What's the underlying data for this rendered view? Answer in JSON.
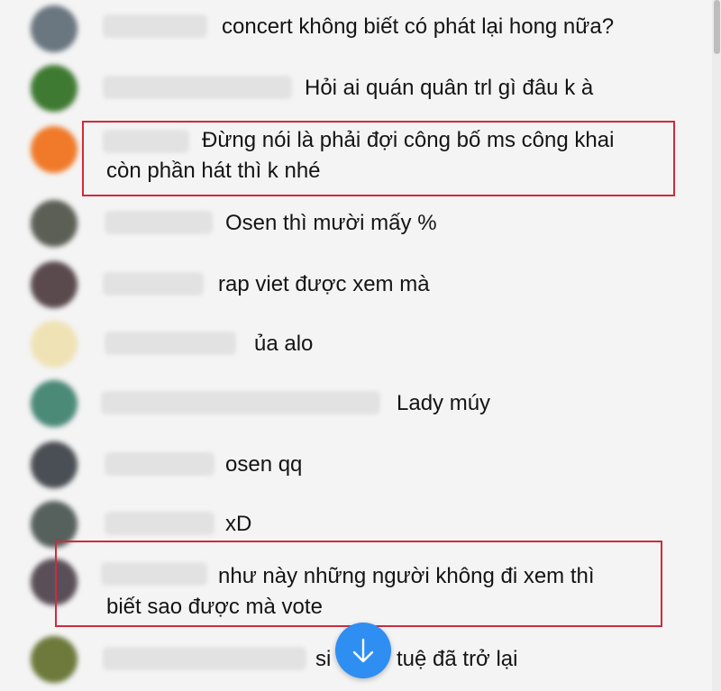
{
  "messages": [
    {
      "text": "concert không biết có phát lại hong nữa?",
      "avatar_color": "#6a7680"
    },
    {
      "text": "Hỏi ai quán quân trl gì đâu k à",
      "avatar_color": "#3f7a32"
    },
    {
      "text_line1": "Đừng nói là phải đợi công bố ms công khai",
      "text_line2": "còn phần hát thì k nhé",
      "avatar_color": "#f07a2a",
      "highlighted": true
    },
    {
      "text": "Osen thì mười mấy %",
      "avatar_color": "#5b5f55"
    },
    {
      "text": "rap viet được xem mà",
      "avatar_color": "#5a4a4e"
    },
    {
      "text": "ủa alo",
      "avatar_color": "#efe2b4"
    },
    {
      "text": "Lady múy",
      "avatar_color": "#4c8a78"
    },
    {
      "text": "osen qq",
      "avatar_color": "#4a4f55"
    },
    {
      "text": "xD",
      "avatar_color": "#56605c"
    },
    {
      "text_line1": "như này những người không đi xem thì",
      "text_line2": "biết sao được mà vote",
      "avatar_color": "#5a4f58",
      "highlighted": true
    },
    {
      "text_start": "si",
      "text_end": "tuệ đã trở lại",
      "avatar_color": "#6d7a3c"
    }
  ],
  "scroll_button": {
    "icon": "arrow-down-icon",
    "color": "#2f8ef1"
  },
  "highlight_color": "#d12a3c"
}
